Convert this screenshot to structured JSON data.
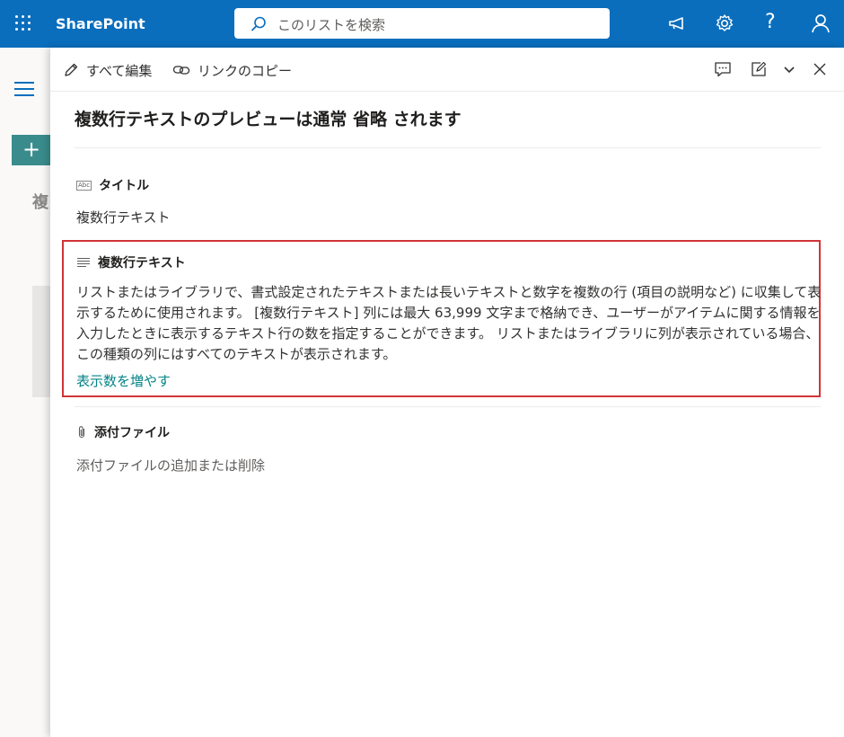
{
  "suitebar": {
    "app_name": "SharePoint",
    "search_placeholder": "このリストを検索",
    "icons": [
      "waffle-icon",
      "search-icon",
      "megaphone-icon",
      "gear-icon",
      "help-icon",
      "person-icon"
    ],
    "help_glyph": "?"
  },
  "panel": {
    "commands": {
      "edit_all": "すべて編集",
      "copy_link": "リンクのコピー"
    },
    "title": "複数行テキストのプレビューは通常 省略 されます",
    "fields": [
      {
        "label": "タイトル",
        "value": "複数行テキスト",
        "icon": "text-field-icon",
        "icon_text": "Abc"
      },
      {
        "label": "複数行テキスト",
        "value": "リストまたはライブラリで、書式設定されたテキストまたは長いテキストと数字を複数の行 (項目の説明など) に収集して表示するために使用されます。 [複数行テキスト] 列には最大 63,999 文字まで格納でき、ユーザーがアイテムに関する情報を入力したときに表示するテキスト行の数を指定することができます。 リストまたはライブラリに列が表示されている場合、この種類の列にはすべてのテキストが表示されます。",
        "show_more": "表示数を増やす",
        "icon": "multiline-text-icon"
      },
      {
        "label": "添付ファイル",
        "value": "添付ファイルの追加または削除",
        "icon": "paperclip-icon"
      }
    ]
  },
  "background": {
    "partial_text": "複",
    "new_button": "+"
  },
  "colors": {
    "suitebar": "#0a6ebd",
    "highlight_border": "#d13438",
    "link": "#038387",
    "new_button": "#3a8c8c"
  }
}
